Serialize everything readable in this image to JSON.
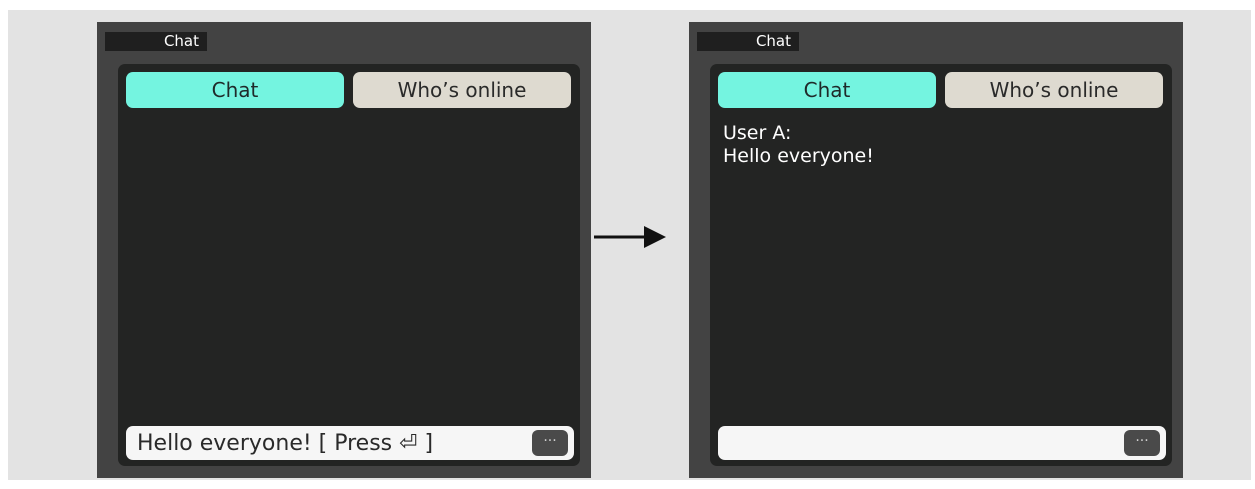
{
  "before": {
    "window_title": "Chat",
    "tabs": {
      "chat": "Chat",
      "online": "Who’s online"
    },
    "input_value": "Hello everyone!  [ Press ⏎ ]",
    "menu_button": "···"
  },
  "after": {
    "window_title": "Chat",
    "tabs": {
      "chat": "Chat",
      "online": "Who’s online"
    },
    "messages": [
      {
        "user": "User A:",
        "text": "Hello everyone!"
      }
    ],
    "input_value": "",
    "menu_button": "···"
  },
  "colors": {
    "background": "#e3e3e3",
    "window": "#434343",
    "panel": "#232423",
    "tab_active": "#74f4e0",
    "tab_inactive": "#dedad0",
    "input": "#f6f6f6"
  },
  "icons": [
    "arrow-right-icon",
    "more-icon"
  ]
}
